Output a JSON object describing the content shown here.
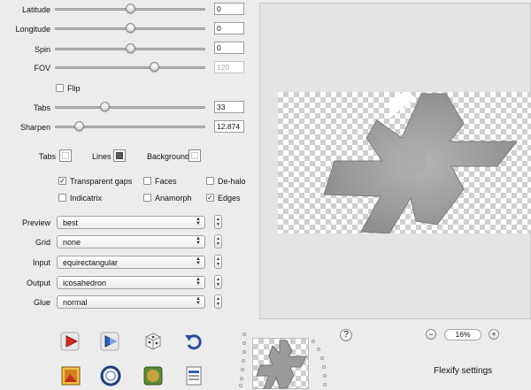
{
  "sliders": [
    {
      "label": "Latitude",
      "value": "0",
      "level": 0.5
    },
    {
      "label": "Longitude",
      "value": "0",
      "level": 0.5
    },
    {
      "label": "Spin",
      "value": "0",
      "level": 0.5
    },
    {
      "label": "FOV",
      "value": "120",
      "level": 0.66,
      "disabled": true
    }
  ],
  "flip": {
    "label": "Flip",
    "checked": false
  },
  "tabs_slider": {
    "label": "Tabs",
    "value": "33",
    "level": 0.33
  },
  "sharpen_slider": {
    "label": "Sharpen",
    "value": "12.874",
    "level": 0.16
  },
  "colors": {
    "tabs_label": "Tabs",
    "lines_label": "Lines",
    "background_label": "Background"
  },
  "options": {
    "transparent_gaps": {
      "label": "Transparent gaps",
      "checked": true
    },
    "faces": {
      "label": "Faces",
      "checked": false
    },
    "dehalo": {
      "label": "De-halo",
      "checked": false
    },
    "indicatrix": {
      "label": "Indicatrix",
      "checked": false
    },
    "anamorph": {
      "label": "Anamorph",
      "checked": false
    },
    "edges": {
      "label": "Edges",
      "checked": true
    }
  },
  "popups": [
    {
      "label": "Preview",
      "value": "best"
    },
    {
      "label": "Grid",
      "value": "none"
    },
    {
      "label": "Input",
      "value": "equirectangular"
    },
    {
      "label": "Output",
      "value": "icosahedron"
    },
    {
      "label": "Glue",
      "value": "normal"
    }
  ],
  "help_label": "?",
  "zoom": {
    "minus": "−",
    "value": "16%",
    "plus": "+"
  },
  "footer_title": "Flexify settings",
  "toolbar_icons": [
    "render-preview-icon",
    "render-forward-icon",
    "random-dice-icon",
    "undo-icon",
    "save-image-icon",
    "globe-ring-icon",
    "map-icon",
    "settings-file-icon"
  ],
  "accent": {
    "arrow_red": "#d62a1e",
    "arrow_blue": "#2b5fb8",
    "glyph_gray": "#9a9a9a"
  }
}
